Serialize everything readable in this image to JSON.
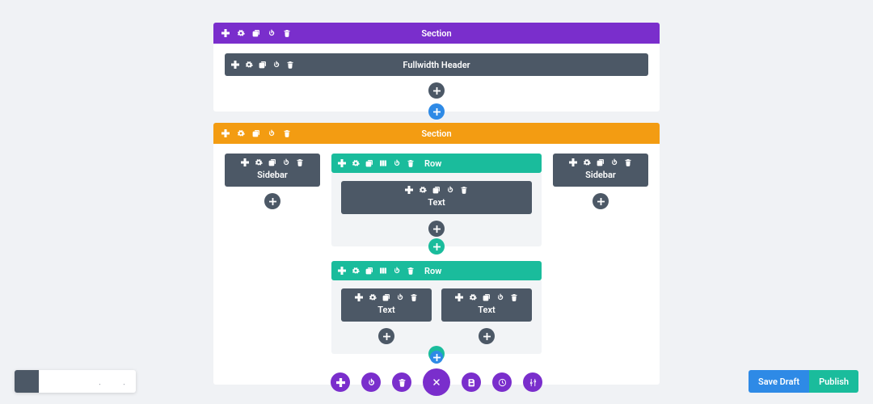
{
  "sections": [
    {
      "color": "purple",
      "label": "Section"
    },
    {
      "color": "orange",
      "label": "Section"
    }
  ],
  "modules": {
    "fullwidth_header": "Fullwidth Header",
    "sidebar_left": "Sidebar",
    "sidebar_right": "Sidebar",
    "row1": "Row",
    "row1_text": "Text",
    "row2": "Row",
    "row2_text_a": "Text",
    "row2_text_b": "Text"
  },
  "footer": {
    "save_draft": "Save Draft",
    "publish": "Publish"
  }
}
